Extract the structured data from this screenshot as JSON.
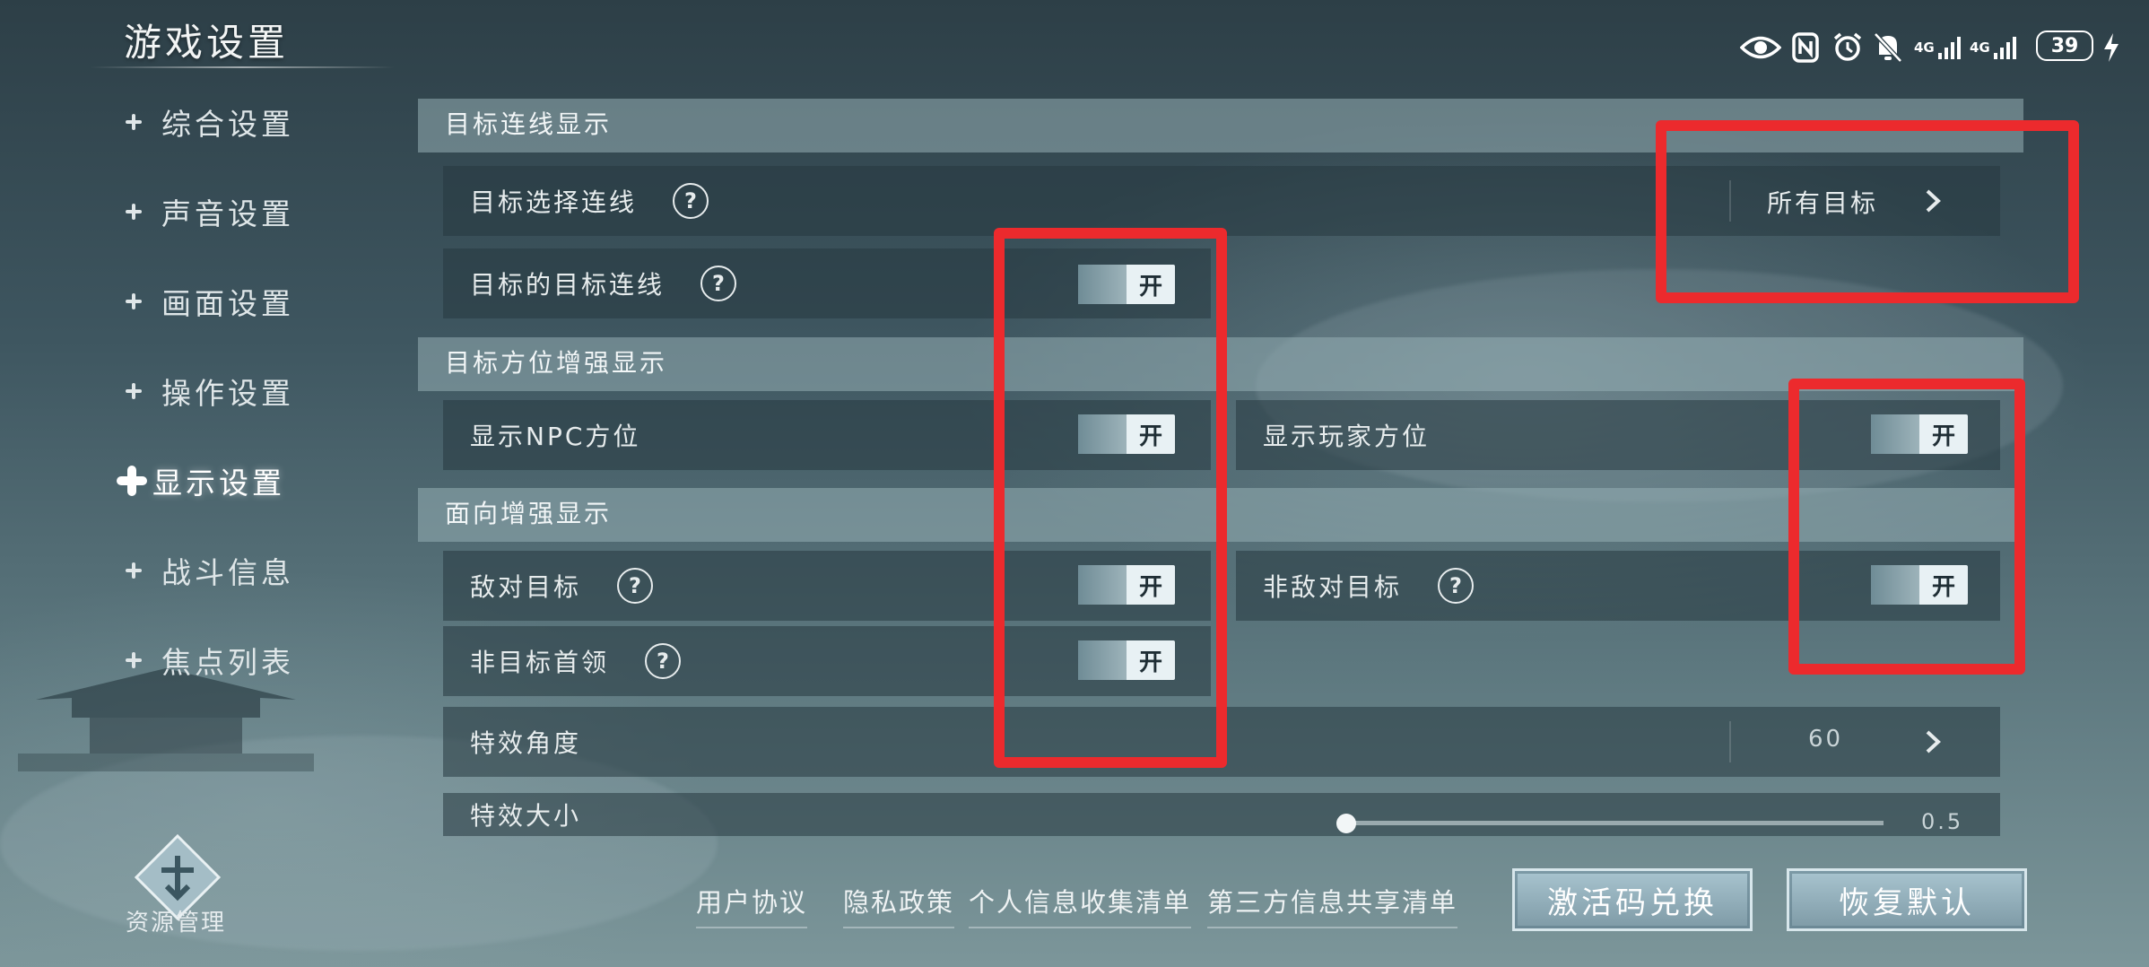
{
  "header": {
    "title": "游戏设置"
  },
  "status_bar": {
    "battery": "39",
    "network_1": "4G",
    "network_2": "4G"
  },
  "sidebar": {
    "items": [
      {
        "label": "综合设置"
      },
      {
        "label": "声音设置"
      },
      {
        "label": "画面设置"
      },
      {
        "label": "操作设置"
      },
      {
        "label": "显示设置",
        "active": true
      },
      {
        "label": "战斗信息"
      },
      {
        "label": "焦点列表"
      }
    ],
    "resource": {
      "label": "资源管理"
    }
  },
  "content": {
    "section_line": "目标连线显示",
    "target_select_line": {
      "label": "目标选择连线",
      "value": "所有目标"
    },
    "target_of_target_line": {
      "label": "目标的目标连线",
      "state": "开"
    },
    "section_direction": "目标方位增强显示",
    "show_npc_dir": {
      "label": "显示NPC方位",
      "state": "开"
    },
    "show_player_dir": {
      "label": "显示玩家方位",
      "state": "开"
    },
    "section_facing": "面向增强显示",
    "hostile_target": {
      "label": "敌对目标",
      "state": "开"
    },
    "non_hostile_target": {
      "label": "非敌对目标",
      "state": "开"
    },
    "non_target_leader": {
      "label": "非目标首领",
      "state": "开"
    },
    "effect_angle": {
      "label": "特效角度",
      "value": "60"
    },
    "effect_size": {
      "label": "特效大小",
      "value": "0.5"
    }
  },
  "footer": {
    "links": [
      "用户协议",
      "隐私政策",
      "个人信息收集清单",
      "第三方信息共享清单"
    ],
    "activate_button": "激活码兑换",
    "reset_button": "恢复默认"
  },
  "colors": {
    "highlight_box": "#ec2a2d",
    "section_bg": "#96afb4",
    "toggle_on_bg": "#e8f1f4"
  }
}
